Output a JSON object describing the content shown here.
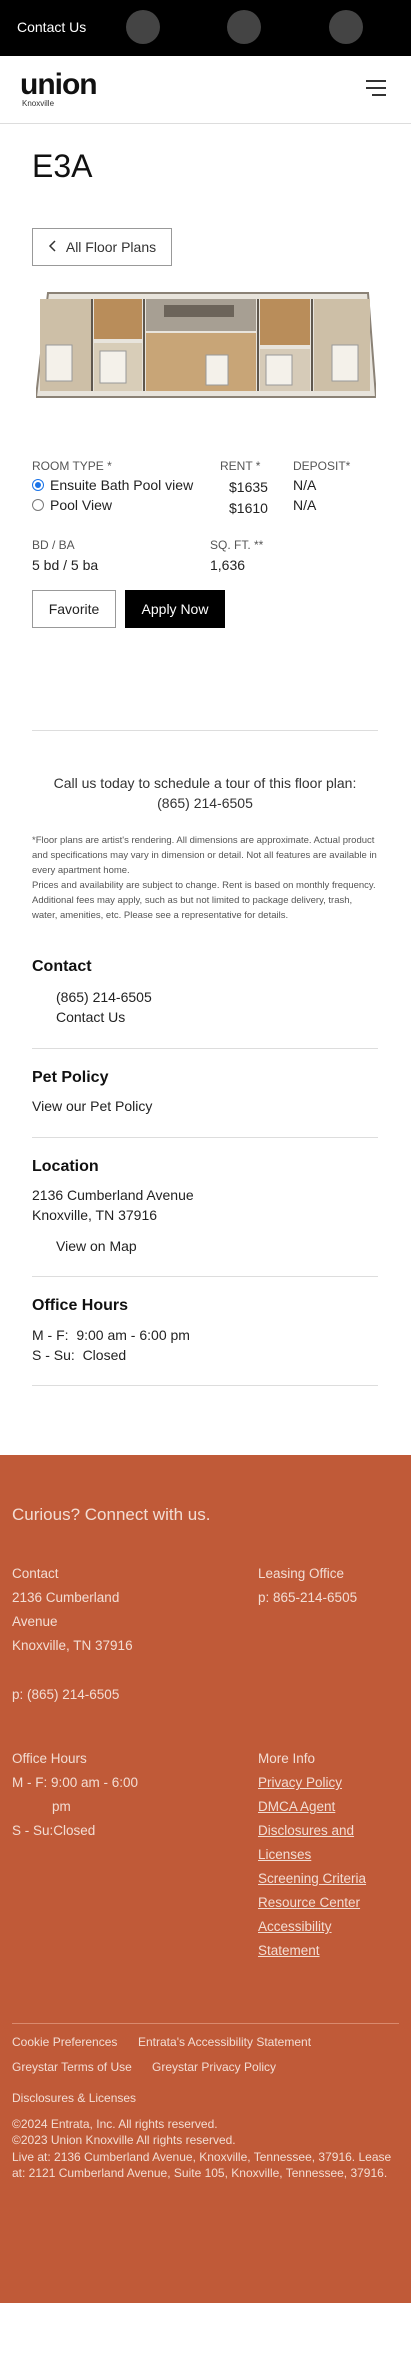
{
  "topbar": {
    "contact_label": "Contact Us"
  },
  "header": {
    "logo_main": "union",
    "logo_sub": "Knoxville"
  },
  "plan": {
    "title": "E3A",
    "back_label": "All Floor Plans",
    "room_type_label": "ROOM TYPE *",
    "rent_label": "RENT *",
    "deposit_label": "DEPOSIT*",
    "options": [
      {
        "name": "Ensuite Bath Pool view",
        "rent": "$1635",
        "deposit": "N/A",
        "selected": true
      },
      {
        "name": "Pool View",
        "rent": "$1610",
        "deposit": "N/A",
        "selected": false
      }
    ],
    "bdba_label": "BD / BA",
    "bdba_value": "5 bd / 5 ba",
    "sqft_label": "SQ. FT. **",
    "sqft_value": "1,636",
    "favorite_label": "Favorite",
    "apply_label": "Apply Now"
  },
  "call": {
    "line1": "Call us today to schedule a tour of this floor plan:",
    "phone": "(865) 214-6505"
  },
  "disclaimer": {
    "p1": "*Floor plans are artist's rendering. All dimensions are approximate. Actual product and specifications may vary in dimension or detail. Not all features are available in every apartment home.",
    "p2": "Prices and availability are subject to change. Rent is based on monthly frequency. Additional fees may apply, such as but not limited to package delivery, trash, water, amenities, etc. Please see a representative for details."
  },
  "contact": {
    "heading": "Contact",
    "phone": "(865) 214-6505",
    "link": "Contact Us"
  },
  "pet": {
    "heading": "Pet Policy",
    "link": "View our Pet Policy"
  },
  "location": {
    "heading": "Location",
    "line1": "2136 Cumberland Avenue",
    "line2": "Knoxville, TN 37916",
    "map_link": "View on Map"
  },
  "hours": {
    "heading": "Office Hours",
    "line1": "M - F:  9:00 am - 6:00 pm",
    "line2": "S - Su:  Closed"
  },
  "footer": {
    "headline": "Curious? Connect with us.",
    "contact_heading": "Contact",
    "addr1": "2136 Cumberland",
    "addr2": "Avenue",
    "addr3": "Knoxville, TN 37916",
    "phone": "p: (865) 214-6505",
    "leasing_heading": "Leasing Office",
    "leasing_phone": "p: 865-214-6505",
    "hours_heading": "Office Hours",
    "hours1": "M - F: 9:00 am - 6:00",
    "hours1b": "pm",
    "hours2": "S - Su:Closed",
    "more_heading": "More Info",
    "links": [
      "Privacy Policy",
      "DMCA Agent",
      "Disclosures and",
      "Licenses",
      "Screening Criteria",
      "Resource Center",
      "Accessibility",
      "Statement"
    ],
    "bottom_links": [
      "Cookie Preferences",
      "Entrata's Accessibility Statement",
      "Greystar Terms of Use",
      "Greystar Privacy Policy",
      "Disclosures & Licenses"
    ],
    "copyright1": "©2024 Entrata, Inc. All rights reserved.",
    "copyright2": "©2023 Union Knoxville All rights reserved.",
    "live_at": "Live at: 2136 Cumberland Avenue, Knoxville, Tennessee, 37916.",
    "lease_at": "Lease at: 2121 Cumberland Avenue, Suite 105, Knoxville, Tennessee, 37916."
  },
  "colors": {
    "footer_bg": "#c05a38",
    "apply_bg": "#000000",
    "radio_selected": "#1a73e8"
  },
  "icons": [
    "chevron-left-icon",
    "hamburger-menu-icon",
    "radio-selected-icon",
    "radio-empty-icon"
  ]
}
